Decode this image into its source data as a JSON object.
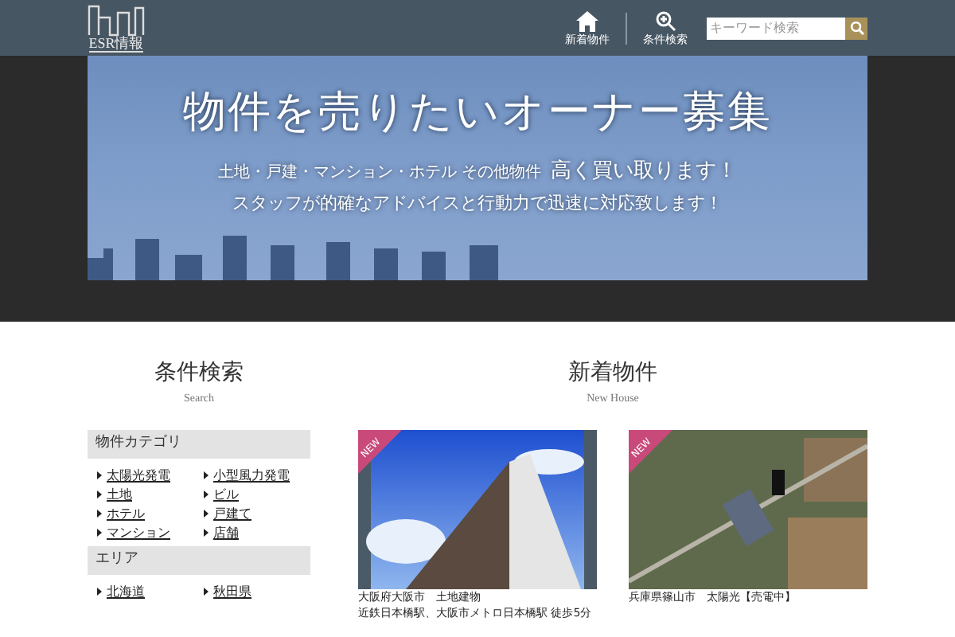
{
  "header": {
    "logo": "ESR情報",
    "nav": [
      {
        "kind": "home",
        "label": "新着物件"
      },
      {
        "kind": "search",
        "label": "条件検索"
      }
    ],
    "search": {
      "placeholder": "キーワード検索"
    }
  },
  "hero": {
    "title": "物件を売りたいオーナー募集",
    "line_1": "土地・戸建・マンション・ホテル その他物件",
    "line_1_emphasis": "高く買い取ります！",
    "line_2": "スタッフが的確なアドバイスと行動力で迅速に対応致します！"
  },
  "search_panel": {
    "title": "条件検索",
    "subtitle": "Search",
    "sections": [
      {
        "heading": "物件カテゴリ",
        "links": [
          "太陽光発電",
          "小型風力発電",
          "土地",
          "ビル",
          "ホテル",
          "戸建て",
          "マンション",
          "店舗"
        ]
      },
      {
        "heading": "エリア",
        "links": [
          "北海道",
          "秋田県"
        ]
      }
    ]
  },
  "new_listings": {
    "title": "新着物件",
    "subtitle": "New House",
    "items": [
      {
        "kind": "building",
        "badge": "NEW",
        "lines": [
          "大阪府大阪市　土地建物",
          "近鉄日本橋駅、大阪市メトロ日本橋駅 徒歩5分"
        ]
      },
      {
        "kind": "aerial",
        "badge": "NEW",
        "lines": [
          "兵庫県篠山市　太陽光【売電中】"
        ]
      }
    ]
  }
}
